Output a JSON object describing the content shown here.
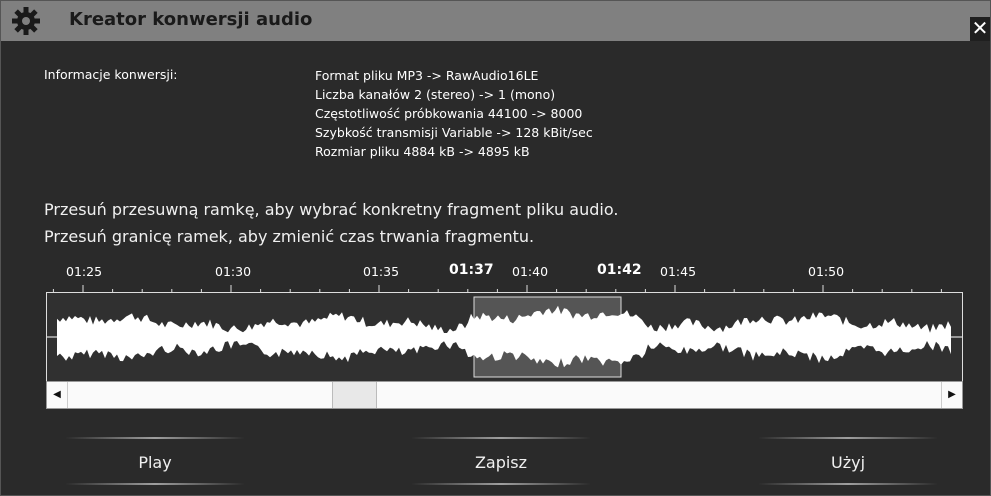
{
  "window": {
    "title": "Kreator konwersji audio",
    "close_glyph": "✕"
  },
  "conversion": {
    "label": "Informacje konwersji:",
    "lines": [
      "Format pliku MP3 -> RawAudio16LE",
      "Liczba kanałów 2 (stereo) -> 1 (mono)",
      "Częstotliwość próbkowania 44100 -> 8000",
      "Szybkość transmisji Variable -> 128 kBit/sec",
      "Rozmiar pliku 4884 kB -> 4895 kB"
    ]
  },
  "instructions": [
    "Przesuń przesuwną ramkę, aby wybrać konkretny fragment pliku audio.",
    "Przesuń granicę ramek, aby zmienić czas trwania fragmentu."
  ],
  "timeline": {
    "ticks": [
      "01:25",
      "01:30",
      "01:35",
      "01:40",
      "01:45",
      "01:50"
    ],
    "selection_start": "01:37",
    "selection_end": "01:42"
  },
  "icons": {
    "gear": "gear-icon",
    "scroll_left": "arrow-left-icon",
    "scroll_right": "arrow-right-icon"
  },
  "colors": {
    "titlebar": "#808080",
    "background": "#2a2a2a",
    "waveform": "#ffffff",
    "selection": "#555555"
  },
  "buttons": {
    "play": "Play",
    "save": "Zapisz",
    "use": "Użyj"
  }
}
